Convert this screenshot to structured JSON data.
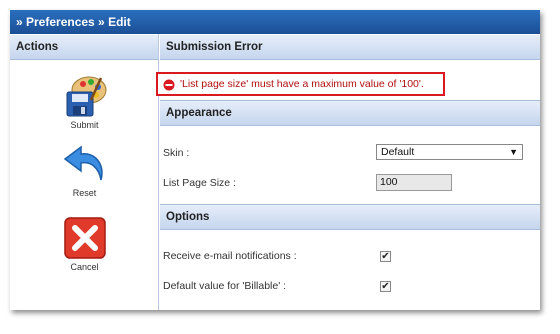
{
  "window": {
    "title": "» Preferences » Edit"
  },
  "sidebar": {
    "header": "Actions",
    "actions": [
      {
        "label": "Submit",
        "icon": "save-icon"
      },
      {
        "label": "Reset",
        "icon": "reset-arrow-icon"
      },
      {
        "label": "Cancel",
        "icon": "cancel-x-icon"
      }
    ]
  },
  "main": {
    "header": "Submission Error",
    "error": {
      "message": "'List page size' must have a maximum value of '100'.",
      "color": "#d9191f"
    },
    "appearance": {
      "title": "Appearance",
      "skin_label": "Skin :",
      "skin_value": "Default",
      "list_page_size_label": "List Page Size :",
      "list_page_size_value": "100"
    },
    "options": {
      "title": "Options",
      "email_label": "Receive e-mail notifications :",
      "email_checked": true,
      "billable_label": "Default value for 'Billable' :",
      "billable_checked": true
    }
  },
  "colors": {
    "titlebar": "#1b4f95",
    "panel": "#c5d6ee",
    "error_border": "#d9191f"
  }
}
